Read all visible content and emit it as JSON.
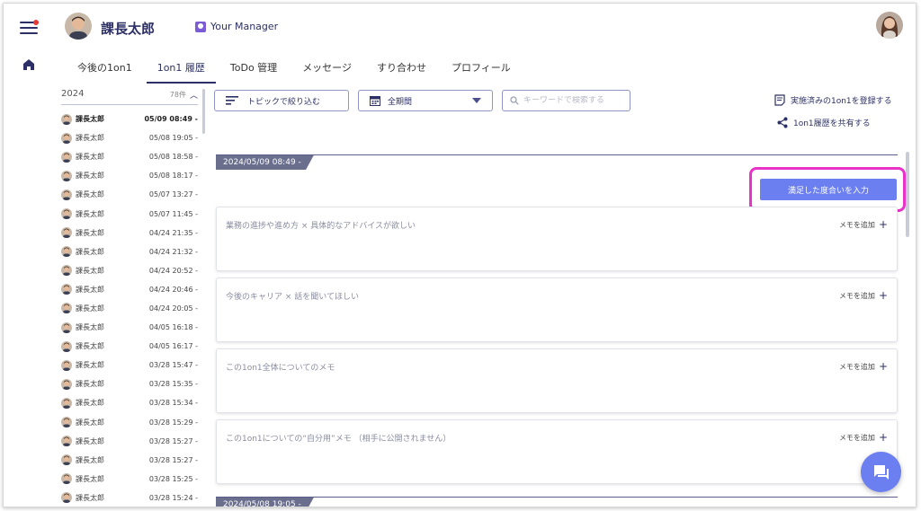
{
  "header": {
    "user_name": "課長太郎",
    "manager_label": "Your Manager"
  },
  "tabs": [
    {
      "label": "今後の1on1"
    },
    {
      "label": "1on1 履歴"
    },
    {
      "label": "ToDo 管理"
    },
    {
      "label": "メッセージ"
    },
    {
      "label": "すり合わせ"
    },
    {
      "label": "プロフィール"
    }
  ],
  "history": {
    "year": "2024",
    "count": "78件",
    "items": [
      {
        "name": "課長太郎",
        "date": "05/09 08:49 -"
      },
      {
        "name": "課長太郎",
        "date": "05/08 19:05 -"
      },
      {
        "name": "課長太郎",
        "date": "05/08 18:58 -"
      },
      {
        "name": "課長太郎",
        "date": "05/08 18:17 -"
      },
      {
        "name": "課長太郎",
        "date": "05/07 13:27 -"
      },
      {
        "name": "課長太郎",
        "date": "05/07 11:45 -"
      },
      {
        "name": "課長太郎",
        "date": "04/24 21:35 -"
      },
      {
        "name": "課長太郎",
        "date": "04/24 21:32 -"
      },
      {
        "name": "課長太郎",
        "date": "04/24 20:52 -"
      },
      {
        "name": "課長太郎",
        "date": "04/24 20:46 -"
      },
      {
        "name": "課長太郎",
        "date": "04/24 20:05 -"
      },
      {
        "name": "課長太郎",
        "date": "04/05 16:18 -"
      },
      {
        "name": "課長太郎",
        "date": "04/05 16:17 -"
      },
      {
        "name": "課長太郎",
        "date": "03/28 15:47 -"
      },
      {
        "name": "課長太郎",
        "date": "03/28 15:35 -"
      },
      {
        "name": "課長太郎",
        "date": "03/28 15:34 -"
      },
      {
        "name": "課長太郎",
        "date": "03/28 15:29 -"
      },
      {
        "name": "課長太郎",
        "date": "03/28 15:27 -"
      },
      {
        "name": "課長太郎",
        "date": "03/28 15:27 -"
      },
      {
        "name": "課長太郎",
        "date": "03/28 15:25 -"
      },
      {
        "name": "課長太郎",
        "date": "03/28 15:24 -"
      }
    ]
  },
  "toolbar": {
    "topic_filter_label": "トピックで絞り込む",
    "period_label": "全期間",
    "search_placeholder": "キーワードで検索する",
    "register_link": "実施済みの1on1を登録する",
    "share_link": "1on1履歴を共有する"
  },
  "session": {
    "date_tag": "2024/05/09 08:49 -",
    "satisfaction_button": "満足した度合いを入力",
    "add_memo_label": "メモを追加",
    "topics": [
      {
        "title": "業務の進捗や進め方 × 具体的なアドバイスが欲しい"
      },
      {
        "title": "今後のキャリア × 話を聞いてほしい"
      },
      {
        "title": "この1on1全体についてのメモ"
      },
      {
        "title": "この1on1についての“自分用”メモ （相手に公開されません）"
      }
    ],
    "next_date_tag": "2024/05/08 19:05 -"
  },
  "colors": {
    "navy": "#2d3066",
    "accent": "#6c7ff0",
    "highlight": "#e832c8",
    "notification": "#e53935"
  }
}
